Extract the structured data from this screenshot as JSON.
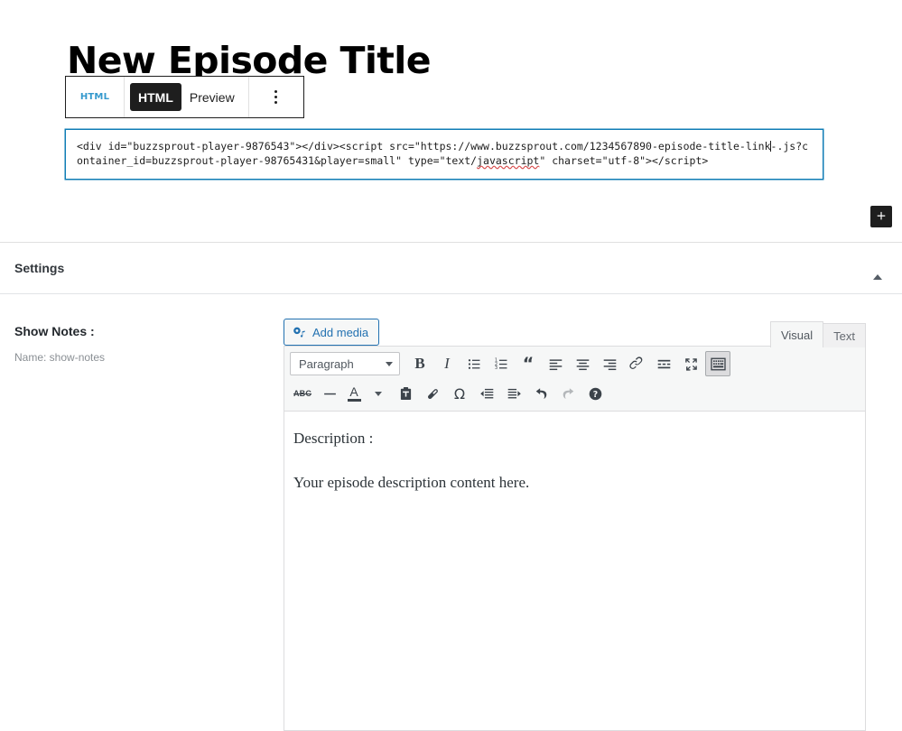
{
  "post": {
    "title": "New Episode Title"
  },
  "block_toolbar": {
    "block_type_icon": "HTML",
    "modes": [
      {
        "label": "HTML",
        "active": true
      },
      {
        "label": "Preview",
        "active": false
      }
    ],
    "more_options_label": "Options"
  },
  "html_block": {
    "code_part1": "<div id=\"buzzsprout-player-9876543\"></div><script src=\"https://www.buzzsprout.com/1234567890-episode-title-link",
    "code_part2": "-.js?container_id=buzzsprout-player-98765431&player=small\" type=\"text/",
    "code_spellcheck_word": "javascript",
    "code_part3": "\" charset=\"utf-8\"></script>"
  },
  "inserter": {
    "label": "+"
  },
  "settings": {
    "title": "Settings",
    "collapse_icon": "caret-up-icon"
  },
  "show_notes": {
    "label": "Show Notes :",
    "name_line": "Name: show-notes"
  },
  "editor": {
    "add_media_label": "Add media",
    "tabs": [
      {
        "label": "Visual",
        "active": true
      },
      {
        "label": "Text",
        "active": false
      }
    ],
    "format_select": {
      "value": "Paragraph"
    },
    "toolbar_row1": [
      {
        "name": "bold-icon",
        "glyph": "B",
        "pressed": false
      },
      {
        "name": "italic-icon",
        "glyph": "I",
        "pressed": false
      },
      {
        "name": "bulleted-list-icon",
        "glyph": "",
        "pressed": false
      },
      {
        "name": "numbered-list-icon",
        "glyph": "",
        "pressed": false
      },
      {
        "name": "blockquote-icon",
        "glyph": "“",
        "pressed": false
      },
      {
        "name": "align-left-icon",
        "glyph": "",
        "pressed": false
      },
      {
        "name": "align-center-icon",
        "glyph": "",
        "pressed": false
      },
      {
        "name": "align-right-icon",
        "glyph": "",
        "pressed": false
      },
      {
        "name": "insert-link-icon",
        "glyph": "",
        "pressed": false
      },
      {
        "name": "read-more-icon",
        "glyph": "",
        "pressed": false
      },
      {
        "name": "fullscreen-icon",
        "glyph": "",
        "pressed": false
      },
      {
        "name": "toolbar-toggle-icon",
        "glyph": "",
        "pressed": true
      }
    ],
    "toolbar_row2": [
      {
        "name": "strikethrough-icon",
        "glyph": "ABC",
        "pressed": false
      },
      {
        "name": "horizontal-line-icon",
        "glyph": "",
        "pressed": false
      },
      {
        "name": "text-color-icon",
        "glyph": "A",
        "pressed": false
      },
      {
        "name": "text-color-dropdown-icon",
        "glyph": "",
        "pressed": false
      },
      {
        "name": "paste-as-text-icon",
        "glyph": "",
        "pressed": false
      },
      {
        "name": "clear-formatting-icon",
        "glyph": "",
        "pressed": false
      },
      {
        "name": "special-character-icon",
        "glyph": "Ω",
        "pressed": false
      },
      {
        "name": "decrease-indent-icon",
        "glyph": "",
        "pressed": false
      },
      {
        "name": "increase-indent-icon",
        "glyph": "",
        "pressed": false
      },
      {
        "name": "undo-icon",
        "glyph": "",
        "pressed": false
      },
      {
        "name": "redo-icon",
        "glyph": "",
        "pressed": false,
        "disabled": true
      },
      {
        "name": "keyboard-shortcuts-icon",
        "glyph": "?",
        "pressed": false
      }
    ],
    "content": {
      "paragraph1": "Description :",
      "paragraph2": "Your episode description content here."
    }
  },
  "colors": {
    "accent_blue": "#2271b1",
    "focus_blue": "#0f7cb5",
    "dark": "#1e1e1e",
    "muted": "#8a8f94",
    "spell_error": "#d94f4f"
  }
}
